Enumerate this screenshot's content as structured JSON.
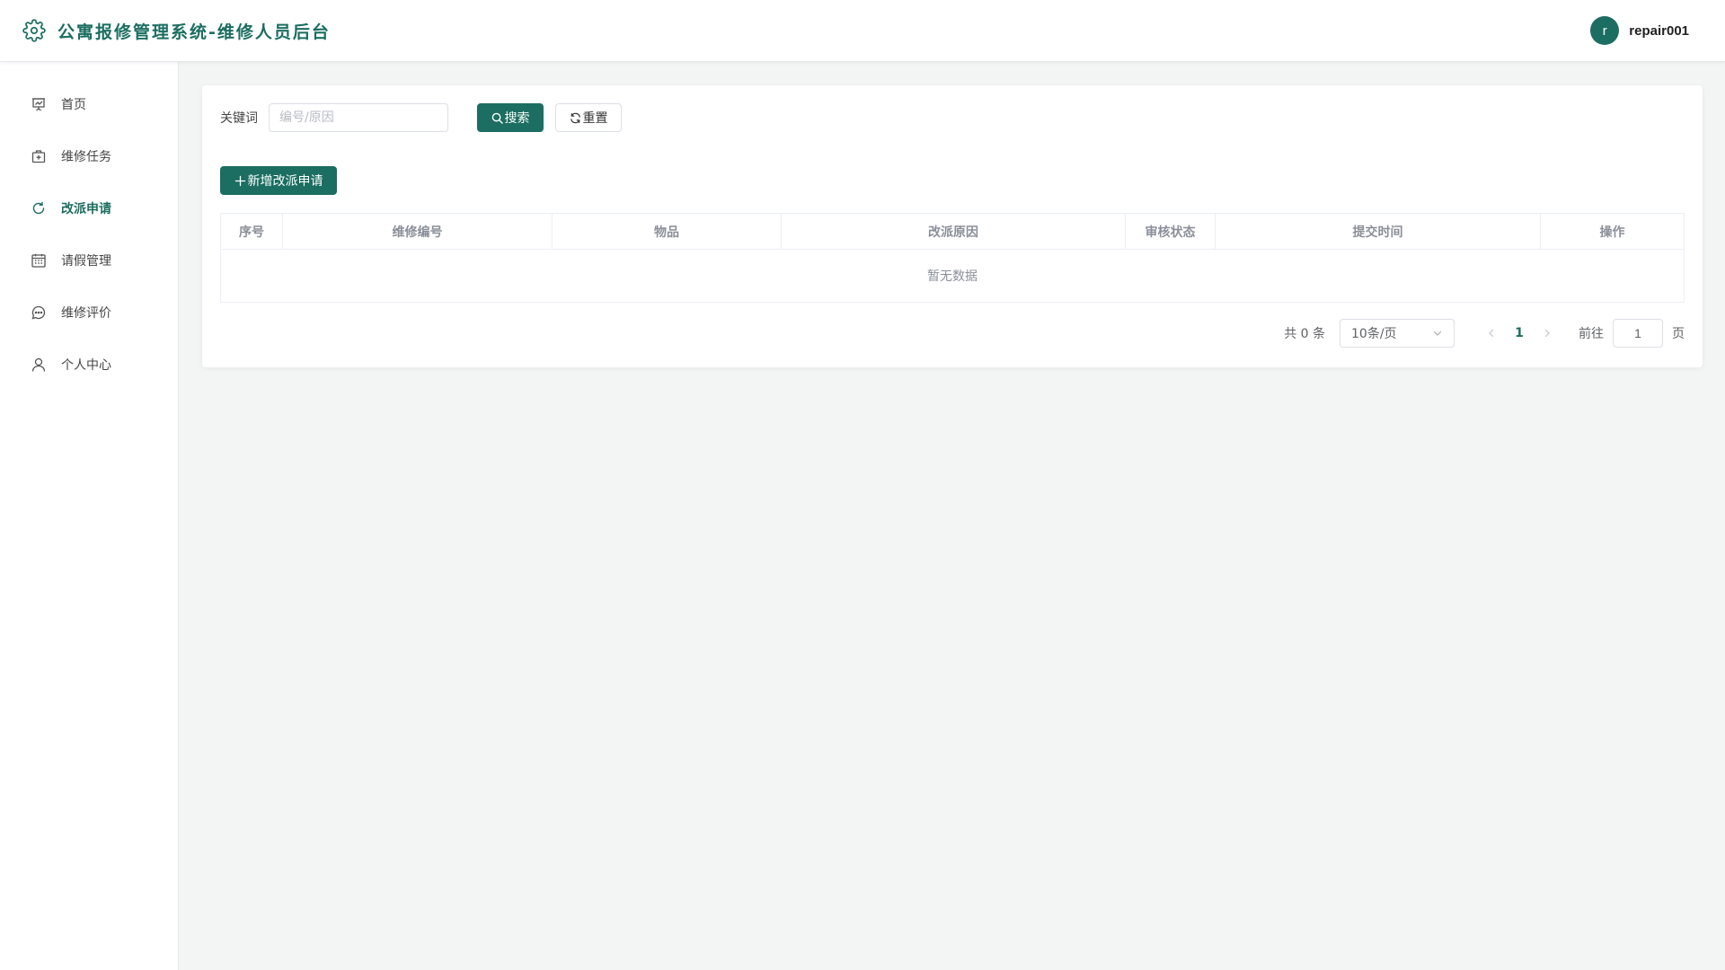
{
  "header": {
    "title": "公寓报修管理系统-维修人员后台",
    "user": {
      "avatar_letter": "r",
      "username": "repair001"
    }
  },
  "colors": {
    "primary": "#1b6e61",
    "background": "#f3f5f4"
  },
  "sidebar": {
    "items": [
      {
        "label": "首页",
        "icon": "presentation-chart-icon"
      },
      {
        "label": "维修任务",
        "icon": "first-aid-kit-icon"
      },
      {
        "label": "改派申请",
        "icon": "refresh-icon",
        "active": true
      },
      {
        "label": "请假管理",
        "icon": "calendar-icon"
      },
      {
        "label": "维修评价",
        "icon": "chat-bubble-icon"
      },
      {
        "label": "个人中心",
        "icon": "user-icon"
      }
    ]
  },
  "search": {
    "keyword_label": "关键词",
    "keyword_placeholder": "编号/原因",
    "keyword_value": "",
    "search_button": "搜索",
    "reset_button": "重置"
  },
  "toolbar": {
    "add_button": "新增改派申请"
  },
  "table": {
    "columns": [
      "序号",
      "维修编号",
      "物品",
      "改派原因",
      "审核状态",
      "提交时间",
      "操作"
    ],
    "rows": [],
    "empty_text": "暂无数据"
  },
  "pagination": {
    "total_text": "共 0 条",
    "page_size": "10条/页",
    "current_page": "1",
    "goto_label": "前往",
    "goto_value": "1",
    "page_unit": "页"
  }
}
